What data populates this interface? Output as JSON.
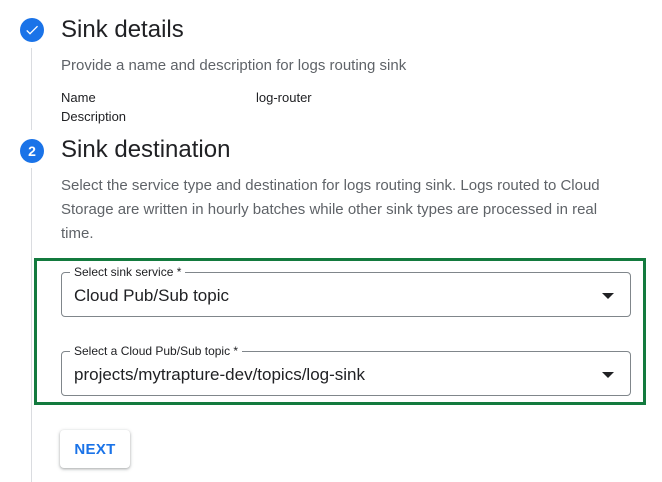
{
  "step1": {
    "number_icon": "check-icon",
    "title": "Sink details",
    "description": "Provide a name and description for logs routing sink",
    "fields": [
      {
        "key": "Name",
        "value": "log-router"
      },
      {
        "key": "Description",
        "value": ""
      }
    ]
  },
  "step2": {
    "number": "2",
    "title": "Sink destination",
    "description_lines": [
      "Select the service type and destination for logs routing sink. Logs routed to Cloud",
      "Storage are written in hourly batches while other sink types are processed in real",
      "time."
    ]
  },
  "sink_service": {
    "label": "Select sink service *",
    "value": "Cloud Pub/Sub topic"
  },
  "pubsub_topic": {
    "label": "Select a Cloud Pub/Sub topic *",
    "value": "projects/mytrapture-dev/topics/log-sink"
  },
  "actions": {
    "next_label": "NEXT"
  },
  "colors": {
    "accent": "#1a73e8",
    "highlight_border": "#137a3e",
    "secondary_text": "#5f6368",
    "line": "#dadce0"
  }
}
